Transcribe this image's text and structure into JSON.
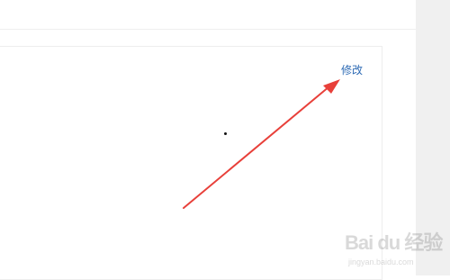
{
  "content": {
    "edit_link_label": "修改"
  },
  "watermark": {
    "brand_text": "Bai du 经验",
    "url_text": "jingyan.baidu.com"
  },
  "annotation": {
    "type": "arrow",
    "color": "#e8403a",
    "target": "edit-link"
  },
  "colors": {
    "link": "#2e6bb5",
    "gutter": "#f0f0f0",
    "border": "#eeeeee"
  }
}
